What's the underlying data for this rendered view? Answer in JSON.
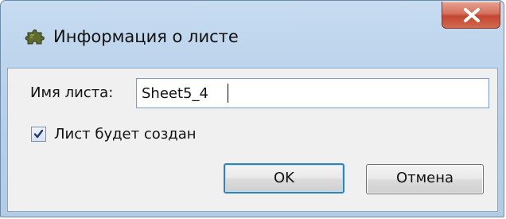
{
  "window": {
    "title": "Информация о листе",
    "icon": "puzzle-piece-icon",
    "close_icon": "close-icon"
  },
  "form": {
    "name_label": "Имя листа:",
    "name_value": "Sheet5_4",
    "checkbox_label": "Лист будет создан",
    "checkbox_checked": true
  },
  "buttons": {
    "ok_label": "OK",
    "cancel_label": "Отмена"
  },
  "colors": {
    "titlebar": "#b9d1ea",
    "close_button": "#c24732",
    "client_background": "#f0f0f0",
    "default_button_border": "#3c7fb1"
  }
}
